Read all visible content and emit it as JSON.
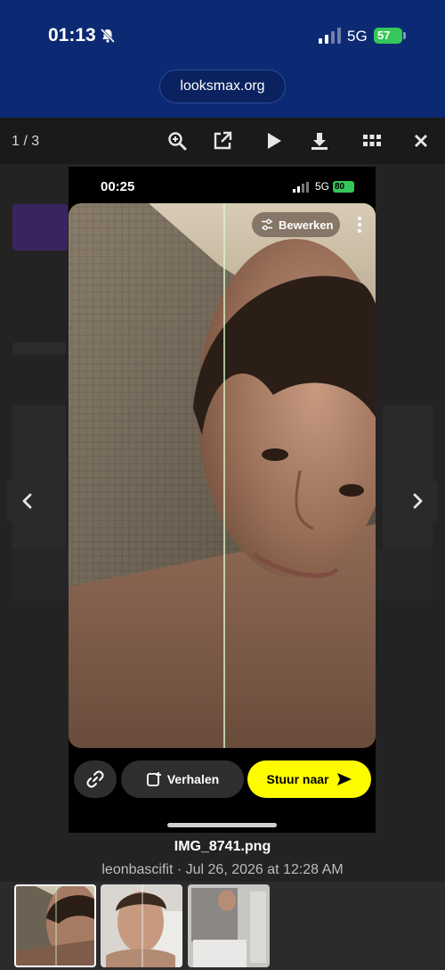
{
  "status_bar": {
    "time": "01:13",
    "network": "5G",
    "battery": "57"
  },
  "browser": {
    "url": "looksmax.org"
  },
  "viewer": {
    "counter": "1 / 3",
    "toolbar_icons": [
      "zoom-in-icon",
      "open-external-icon",
      "play-icon",
      "download-icon",
      "grid-icon",
      "close-icon"
    ]
  },
  "screenshot": {
    "time": "00:25",
    "network": "5G",
    "battery": "80",
    "edit_label": "Bewerken",
    "stories_label": "Verhalen",
    "send_label": "Stuur naar"
  },
  "caption": {
    "filename": "IMG_8741.png",
    "meta": "leonbascifit · Jul 26, 2026 at 12:28 AM"
  },
  "colors": {
    "status_bg": "#0c2a73",
    "send_button": "#fffc00",
    "battery_green": "#34c759"
  }
}
